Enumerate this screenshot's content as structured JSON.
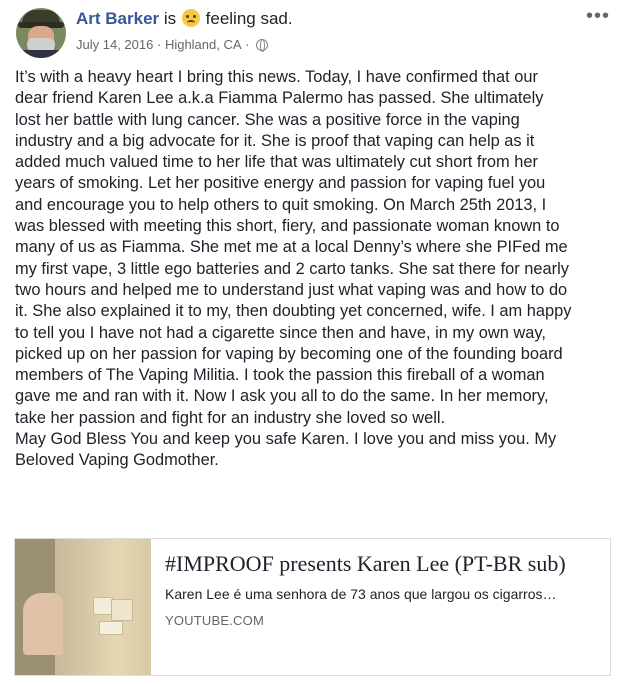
{
  "author": {
    "name": "Art Barker",
    "verb": "is",
    "feeling": "feeling sad.",
    "feeling_icon": "sad-face-emoji"
  },
  "meta": {
    "date": "July 14, 2016",
    "separator": "·",
    "location": "Highland, CA",
    "separator2": "·",
    "privacy_icon": "globe-icon"
  },
  "options_icon": "more-options-icon",
  "post": {
    "text": "It’s with a heavy heart I bring this news. Today, I have confirmed that our\ndear friend Karen Lee a.k.a Fiamma Palermo has passed. She ultimately\nlost her battle with lung cancer. She was a positive force in the vaping\nindustry and a big advocate for it. She is proof that vaping can help as it\nadded much valued time to her life that was ultimately cut short from her\nyears of smoking. Let her positive energy and passion for vaping fuel you\nand encourage you to help others to quit smoking. On March 25th 2013, I\nwas blessed with meeting this short, fiery, and passionate woman known to\nmany of us as Fiamma. She met me at a local Denny’s where she PIFed me\nmy first vape, 3 little ego batteries and 2 carto tanks. She sat there for nearly\ntwo hours and helped me to understand just what vaping was and how to do\nit. She also explained it to my, then doubting yet concerned, wife. I am happy\nto tell you I have not had a cigarette since then and have, in my own way,\npicked up on her passion for vaping by becoming one of the founding board\nmembers of The Vaping Militia. I took the passion this fireball of a woman\ngave me and ran with it. Now I ask you all to do the same. In her memory,\ntake her passion and fight for an industry she loved so well.\nMay God Bless You and keep you safe Karen. I love you and miss you. My\nBeloved Vaping Godmother."
  },
  "link_card": {
    "title": "#IMPROOF presents Karen Lee (PT-BR sub)",
    "description": "Karen Lee é uma senhora de 73 anos que largou os cigarros…",
    "domain": "YOUTUBE.COM"
  }
}
